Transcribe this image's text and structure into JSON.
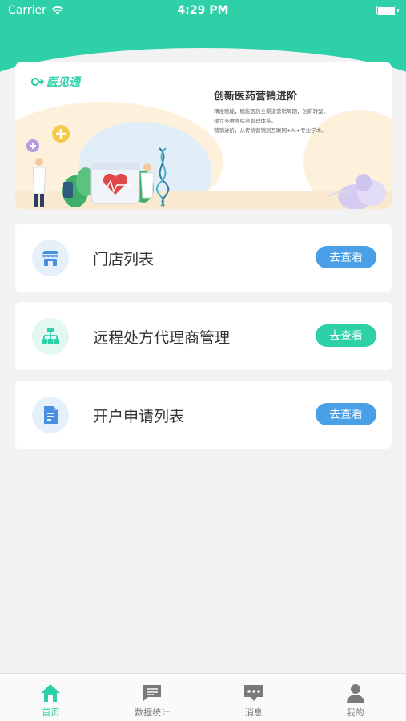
{
  "status_bar": {
    "carrier": "Carrier",
    "time": "4:29 PM"
  },
  "banner": {
    "logo_text": "医见通",
    "title": "创新医药营销进阶",
    "lines": [
      "精准赋能，赋能医药全渠道营销周期，创新转型，",
      "建立多维度综合管理体系。",
      "营销进阶，从传统营销到互联网+AI+专业学术。"
    ]
  },
  "cards": [
    {
      "title": "门店列表",
      "button": "去查看",
      "icon": "store-icon",
      "icon_color": "#4a8fe2",
      "circle_color": "#e6f0fb",
      "button_color": "#4aa0e6"
    },
    {
      "title": "远程处方代理商管理",
      "button": "去查看",
      "icon": "org-chart-icon",
      "icon_color": "#2ed0a8",
      "circle_color": "#e3f8f3",
      "button_color": "#2ed0a8"
    },
    {
      "title": "开户申请列表",
      "button": "去查看",
      "icon": "document-icon",
      "icon_color": "#4a8fe2",
      "circle_color": "#e6f0fb",
      "button_color": "#4aa0e6"
    }
  ],
  "tabbar": [
    {
      "label": "首页",
      "icon": "home-icon",
      "active": true
    },
    {
      "label": "数据统计",
      "icon": "chat-bubble-icon",
      "active": false
    },
    {
      "label": "消息",
      "icon": "message-icon",
      "active": false
    },
    {
      "label": "我的",
      "icon": "user-icon",
      "active": false
    }
  ],
  "colors": {
    "accent": "#2ed0a8",
    "background": "#f2f2f2",
    "inactive_tab": "#7a7a7a"
  }
}
